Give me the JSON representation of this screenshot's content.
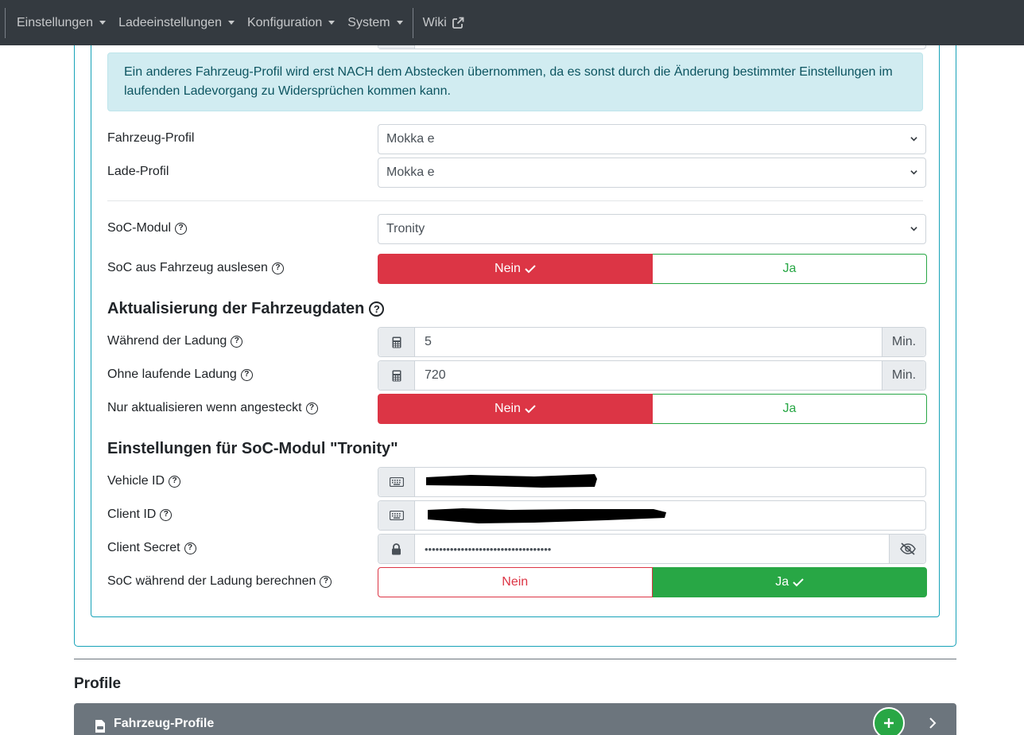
{
  "navbar": {
    "items": [
      {
        "label": "Einstellungen"
      },
      {
        "label": "Ladeeinstellungen"
      },
      {
        "label": "Konfiguration"
      },
      {
        "label": "System"
      }
    ],
    "wiki_label": "Wiki"
  },
  "alert_text": "Ein anderes Fahrzeug-Profil wird erst NACH dem Abstecken übernommen, da es sonst durch die Änderung bestimmter Einstellungen im laufenden Ladevorgang zu Widersprüchen kommen kann.",
  "vehicle_profile": {
    "label": "Fahrzeug-Profil",
    "value": "Mokka e"
  },
  "charge_profile": {
    "label": "Lade-Profil",
    "value": "Mokka e"
  },
  "soc_module": {
    "label": "SoC-Modul",
    "value": "Tronity"
  },
  "soc_from_vehicle": {
    "label": "SoC aus Fahrzeug auslesen",
    "no": "Nein",
    "yes": "Ja",
    "selected": "Nein"
  },
  "update_section": {
    "title": "Aktualisierung der Fahrzeugdaten",
    "during_charge": {
      "label": "Während der Ladung",
      "value": "5",
      "unit": "Min."
    },
    "no_charge": {
      "label": "Ohne laufende Ladung",
      "value": "720",
      "unit": "Min."
    },
    "only_plugged": {
      "label": "Nur aktualisieren wenn angesteckt",
      "no": "Nein",
      "yes": "Ja",
      "selected": "Nein"
    }
  },
  "module_section": {
    "title": "Einstellungen für SoC-Modul \"Tronity\"",
    "vehicle_id": {
      "label": "Vehicle ID"
    },
    "client_id": {
      "label": "Client ID"
    },
    "client_secret": {
      "label": "Client Secret",
      "value": "•••••••••••••••••••••••••••••••••••"
    },
    "calc_soc": {
      "label": "SoC während der Ladung berechnen",
      "no": "Nein",
      "yes": "Ja",
      "selected": "Ja"
    }
  },
  "profiles": {
    "heading": "Profile",
    "bar_title": "Fahrzeug-Profile"
  },
  "colors": {
    "navbar": "#343a40",
    "card_border": "#17a2b8",
    "danger": "#dc3545",
    "success": "#28a745",
    "alert_bg": "#d1ecf1",
    "profile_bar": "#6c757d"
  }
}
